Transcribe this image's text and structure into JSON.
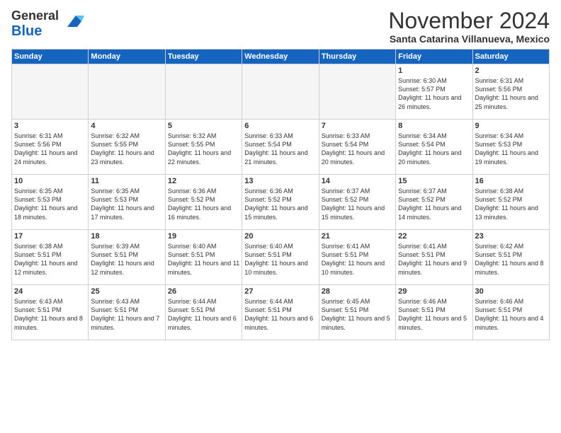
{
  "header": {
    "logo_line1": "General",
    "logo_line2": "Blue",
    "month": "November 2024",
    "location": "Santa Catarina Villanueva, Mexico"
  },
  "days_of_week": [
    "Sunday",
    "Monday",
    "Tuesday",
    "Wednesday",
    "Thursday",
    "Friday",
    "Saturday"
  ],
  "weeks": [
    [
      {
        "day": "",
        "info": ""
      },
      {
        "day": "",
        "info": ""
      },
      {
        "day": "",
        "info": ""
      },
      {
        "day": "",
        "info": ""
      },
      {
        "day": "",
        "info": ""
      },
      {
        "day": "1",
        "info": "Sunrise: 6:30 AM\nSunset: 5:57 PM\nDaylight: 11 hours and 26 minutes."
      },
      {
        "day": "2",
        "info": "Sunrise: 6:31 AM\nSunset: 5:56 PM\nDaylight: 11 hours and 25 minutes."
      }
    ],
    [
      {
        "day": "3",
        "info": "Sunrise: 6:31 AM\nSunset: 5:56 PM\nDaylight: 11 hours and 24 minutes."
      },
      {
        "day": "4",
        "info": "Sunrise: 6:32 AM\nSunset: 5:55 PM\nDaylight: 11 hours and 23 minutes."
      },
      {
        "day": "5",
        "info": "Sunrise: 6:32 AM\nSunset: 5:55 PM\nDaylight: 11 hours and 22 minutes."
      },
      {
        "day": "6",
        "info": "Sunrise: 6:33 AM\nSunset: 5:54 PM\nDaylight: 11 hours and 21 minutes."
      },
      {
        "day": "7",
        "info": "Sunrise: 6:33 AM\nSunset: 5:54 PM\nDaylight: 11 hours and 20 minutes."
      },
      {
        "day": "8",
        "info": "Sunrise: 6:34 AM\nSunset: 5:54 PM\nDaylight: 11 hours and 20 minutes."
      },
      {
        "day": "9",
        "info": "Sunrise: 6:34 AM\nSunset: 5:53 PM\nDaylight: 11 hours and 19 minutes."
      }
    ],
    [
      {
        "day": "10",
        "info": "Sunrise: 6:35 AM\nSunset: 5:53 PM\nDaylight: 11 hours and 18 minutes."
      },
      {
        "day": "11",
        "info": "Sunrise: 6:35 AM\nSunset: 5:53 PM\nDaylight: 11 hours and 17 minutes."
      },
      {
        "day": "12",
        "info": "Sunrise: 6:36 AM\nSunset: 5:52 PM\nDaylight: 11 hours and 16 minutes."
      },
      {
        "day": "13",
        "info": "Sunrise: 6:36 AM\nSunset: 5:52 PM\nDaylight: 11 hours and 15 minutes."
      },
      {
        "day": "14",
        "info": "Sunrise: 6:37 AM\nSunset: 5:52 PM\nDaylight: 11 hours and 15 minutes."
      },
      {
        "day": "15",
        "info": "Sunrise: 6:37 AM\nSunset: 5:52 PM\nDaylight: 11 hours and 14 minutes."
      },
      {
        "day": "16",
        "info": "Sunrise: 6:38 AM\nSunset: 5:52 PM\nDaylight: 11 hours and 13 minutes."
      }
    ],
    [
      {
        "day": "17",
        "info": "Sunrise: 6:38 AM\nSunset: 5:51 PM\nDaylight: 11 hours and 12 minutes."
      },
      {
        "day": "18",
        "info": "Sunrise: 6:39 AM\nSunset: 5:51 PM\nDaylight: 11 hours and 12 minutes."
      },
      {
        "day": "19",
        "info": "Sunrise: 6:40 AM\nSunset: 5:51 PM\nDaylight: 11 hours and 11 minutes."
      },
      {
        "day": "20",
        "info": "Sunrise: 6:40 AM\nSunset: 5:51 PM\nDaylight: 11 hours and 10 minutes."
      },
      {
        "day": "21",
        "info": "Sunrise: 6:41 AM\nSunset: 5:51 PM\nDaylight: 11 hours and 10 minutes."
      },
      {
        "day": "22",
        "info": "Sunrise: 6:41 AM\nSunset: 5:51 PM\nDaylight: 11 hours and 9 minutes."
      },
      {
        "day": "23",
        "info": "Sunrise: 6:42 AM\nSunset: 5:51 PM\nDaylight: 11 hours and 8 minutes."
      }
    ],
    [
      {
        "day": "24",
        "info": "Sunrise: 6:43 AM\nSunset: 5:51 PM\nDaylight: 11 hours and 8 minutes."
      },
      {
        "day": "25",
        "info": "Sunrise: 6:43 AM\nSunset: 5:51 PM\nDaylight: 11 hours and 7 minutes."
      },
      {
        "day": "26",
        "info": "Sunrise: 6:44 AM\nSunset: 5:51 PM\nDaylight: 11 hours and 6 minutes."
      },
      {
        "day": "27",
        "info": "Sunrise: 6:44 AM\nSunset: 5:51 PM\nDaylight: 11 hours and 6 minutes."
      },
      {
        "day": "28",
        "info": "Sunrise: 6:45 AM\nSunset: 5:51 PM\nDaylight: 11 hours and 5 minutes."
      },
      {
        "day": "29",
        "info": "Sunrise: 6:46 AM\nSunset: 5:51 PM\nDaylight: 11 hours and 5 minutes."
      },
      {
        "day": "30",
        "info": "Sunrise: 6:46 AM\nSunset: 5:51 PM\nDaylight: 11 hours and 4 minutes."
      }
    ]
  ]
}
